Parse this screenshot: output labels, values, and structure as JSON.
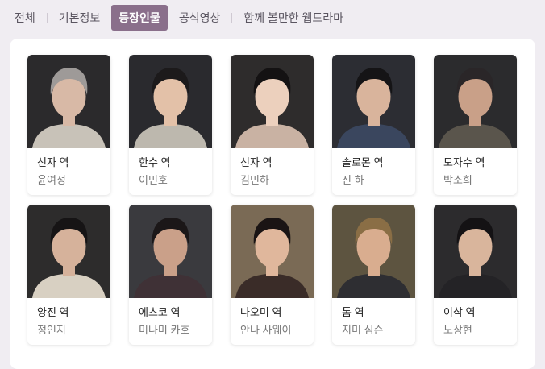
{
  "tabs": [
    {
      "label": "전체"
    },
    {
      "label": "기본정보"
    },
    {
      "label": "등장인물"
    },
    {
      "label": "공식영상"
    },
    {
      "label": "함께 볼만한 웹드라마"
    }
  ],
  "active_tab_index": 2,
  "cast": [
    {
      "role": "선자 역",
      "actor": "윤여정",
      "bg": "#2b2a2c",
      "hair": "#9e9a98",
      "skin": "#d8b9a6",
      "cloth": "#c8c2b8"
    },
    {
      "role": "한수 역",
      "actor": "이민호",
      "bg": "#2a2a2e",
      "hair": "#1c1a1b",
      "skin": "#e3c1a8",
      "cloth": "#bdb8ae"
    },
    {
      "role": "선자 역",
      "actor": "김민하",
      "bg": "#2e2c2c",
      "hair": "#141213",
      "skin": "#ecd0bd",
      "cloth": "#c9b2a3"
    },
    {
      "role": "솔로몬 역",
      "actor": "진 하",
      "bg": "#2c2d33",
      "hair": "#151416",
      "skin": "#d9b49c",
      "cloth": "#3a465e"
    },
    {
      "role": "모자수 역",
      "actor": "박소희",
      "bg": "#2b2b2d",
      "hair": "#2a2628",
      "skin": "#c9a088",
      "cloth": "#5a554c"
    },
    {
      "role": "양진 역",
      "actor": "정인지",
      "bg": "#2d2c2c",
      "hair": "#161415",
      "skin": "#d6b29b",
      "cloth": "#d8d0c2"
    },
    {
      "role": "에츠코 역",
      "actor": "미나미 카호",
      "bg": "#3a3a3e",
      "hair": "#1b1718",
      "skin": "#caa089",
      "cloth": "#3f3136"
    },
    {
      "role": "나오미 역",
      "actor": "안나 사웨이",
      "bg": "#7a6a55",
      "hair": "#1a1414",
      "skin": "#e0b79c",
      "cloth": "#3a2c28"
    },
    {
      "role": "톰 역",
      "actor": "지미 심슨",
      "bg": "#5d5440",
      "hair": "#8a6e45",
      "skin": "#d9ad8f",
      "cloth": "#2e2e32"
    },
    {
      "role": "이삭 역",
      "actor": "노상현",
      "bg": "#2c2b2d",
      "hair": "#141214",
      "skin": "#d9b59c",
      "cloth": "#242326"
    }
  ]
}
